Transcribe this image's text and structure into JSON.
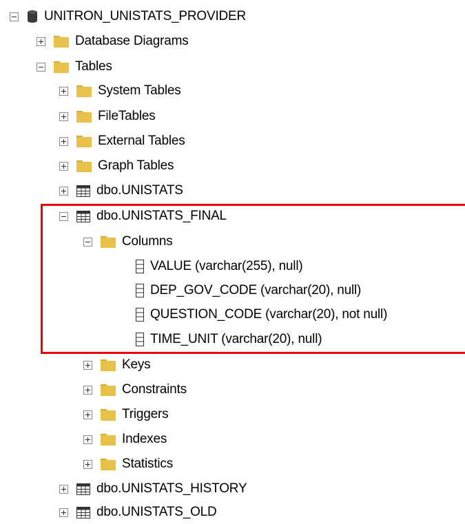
{
  "tree": {
    "database": {
      "label": "UNITRON_UNISTATS_PROVIDER",
      "icon": "database-icon"
    },
    "database_diagrams": {
      "label": "Database Diagrams",
      "icon": "folder-icon"
    },
    "tables": {
      "label": "Tables",
      "icon": "folder-icon"
    },
    "system_tables": {
      "label": "System Tables",
      "icon": "folder-icon"
    },
    "file_tables": {
      "label": "FileTables",
      "icon": "folder-icon"
    },
    "external_tables": {
      "label": "External Tables",
      "icon": "folder-icon"
    },
    "graph_tables": {
      "label": "Graph Tables",
      "icon": "folder-icon"
    },
    "unistats": {
      "label": "dbo.UNISTATS",
      "icon": "table-icon"
    },
    "unistats_final": {
      "label": "dbo.UNISTATS_FINAL",
      "icon": "table-icon"
    },
    "columns": {
      "label": "Columns",
      "icon": "folder-icon"
    },
    "column_items": [
      {
        "label": "VALUE (varchar(255), null)",
        "icon": "column-icon"
      },
      {
        "label": "DEP_GOV_CODE (varchar(20), null)",
        "icon": "column-icon"
      },
      {
        "label": "QUESTION_CODE (varchar(20), not null)",
        "icon": "column-icon"
      },
      {
        "label": "TIME_UNIT (varchar(20), null)",
        "icon": "column-icon"
      }
    ],
    "keys": {
      "label": "Keys",
      "icon": "folder-icon"
    },
    "constraints": {
      "label": "Constraints",
      "icon": "folder-icon"
    },
    "triggers": {
      "label": "Triggers",
      "icon": "folder-icon"
    },
    "indexes": {
      "label": "Indexes",
      "icon": "folder-icon"
    },
    "statistics": {
      "label": "Statistics",
      "icon": "folder-icon"
    },
    "unistats_history": {
      "label": "dbo.UNISTATS_HISTORY",
      "icon": "table-icon"
    },
    "unistats_old": {
      "label": "dbo.UNISTATS_OLD",
      "icon": "table-icon"
    }
  },
  "colors": {
    "highlight": "#ee0000",
    "folder": "#e8c14a",
    "table_icon": "#333333"
  }
}
